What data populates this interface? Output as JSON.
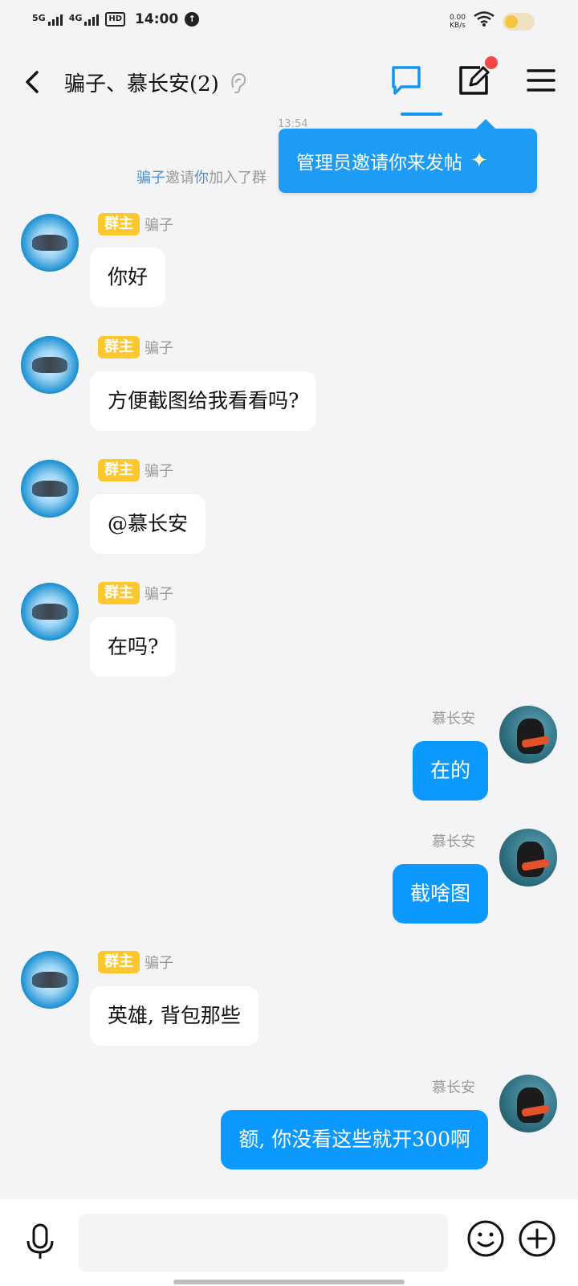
{
  "status_bar": {
    "sim1": "5G",
    "sim2": "4G",
    "hd": "HD",
    "time": "14:00",
    "speed_value": "0.00",
    "speed_unit": "KB/s"
  },
  "header": {
    "title": "骗子、慕长安(2)"
  },
  "tooltip": {
    "text": "管理员邀请你来发帖",
    "icon": "sparkle-icon"
  },
  "system": {
    "time": "13:54",
    "inviter": "骗子",
    "invite_word": "邀请",
    "invitee": "你",
    "action": "加入了群"
  },
  "messages": [
    {
      "side": "left",
      "badge": "群主",
      "sender": "骗子",
      "text": "你好"
    },
    {
      "side": "left",
      "badge": "群主",
      "sender": "骗子",
      "text": "方便截图给我看看吗?"
    },
    {
      "side": "left",
      "badge": "群主",
      "sender": "骗子",
      "text": "@慕长安"
    },
    {
      "side": "left",
      "badge": "群主",
      "sender": "骗子",
      "text": "在吗?"
    },
    {
      "side": "right",
      "sender": "慕长安",
      "text": "在的"
    },
    {
      "side": "right",
      "sender": "慕长安",
      "text": "截啥图"
    },
    {
      "side": "left",
      "badge": "群主",
      "sender": "骗子",
      "text": "英雄, 背包那些"
    },
    {
      "side": "right",
      "sender": "慕长安",
      "text": "额, 你没看这些就开300啊"
    }
  ],
  "colors": {
    "accent": "#0c99ff",
    "badge": "#fdc72f",
    "background": "#f4f4f6",
    "notification_dot": "#f24848"
  }
}
